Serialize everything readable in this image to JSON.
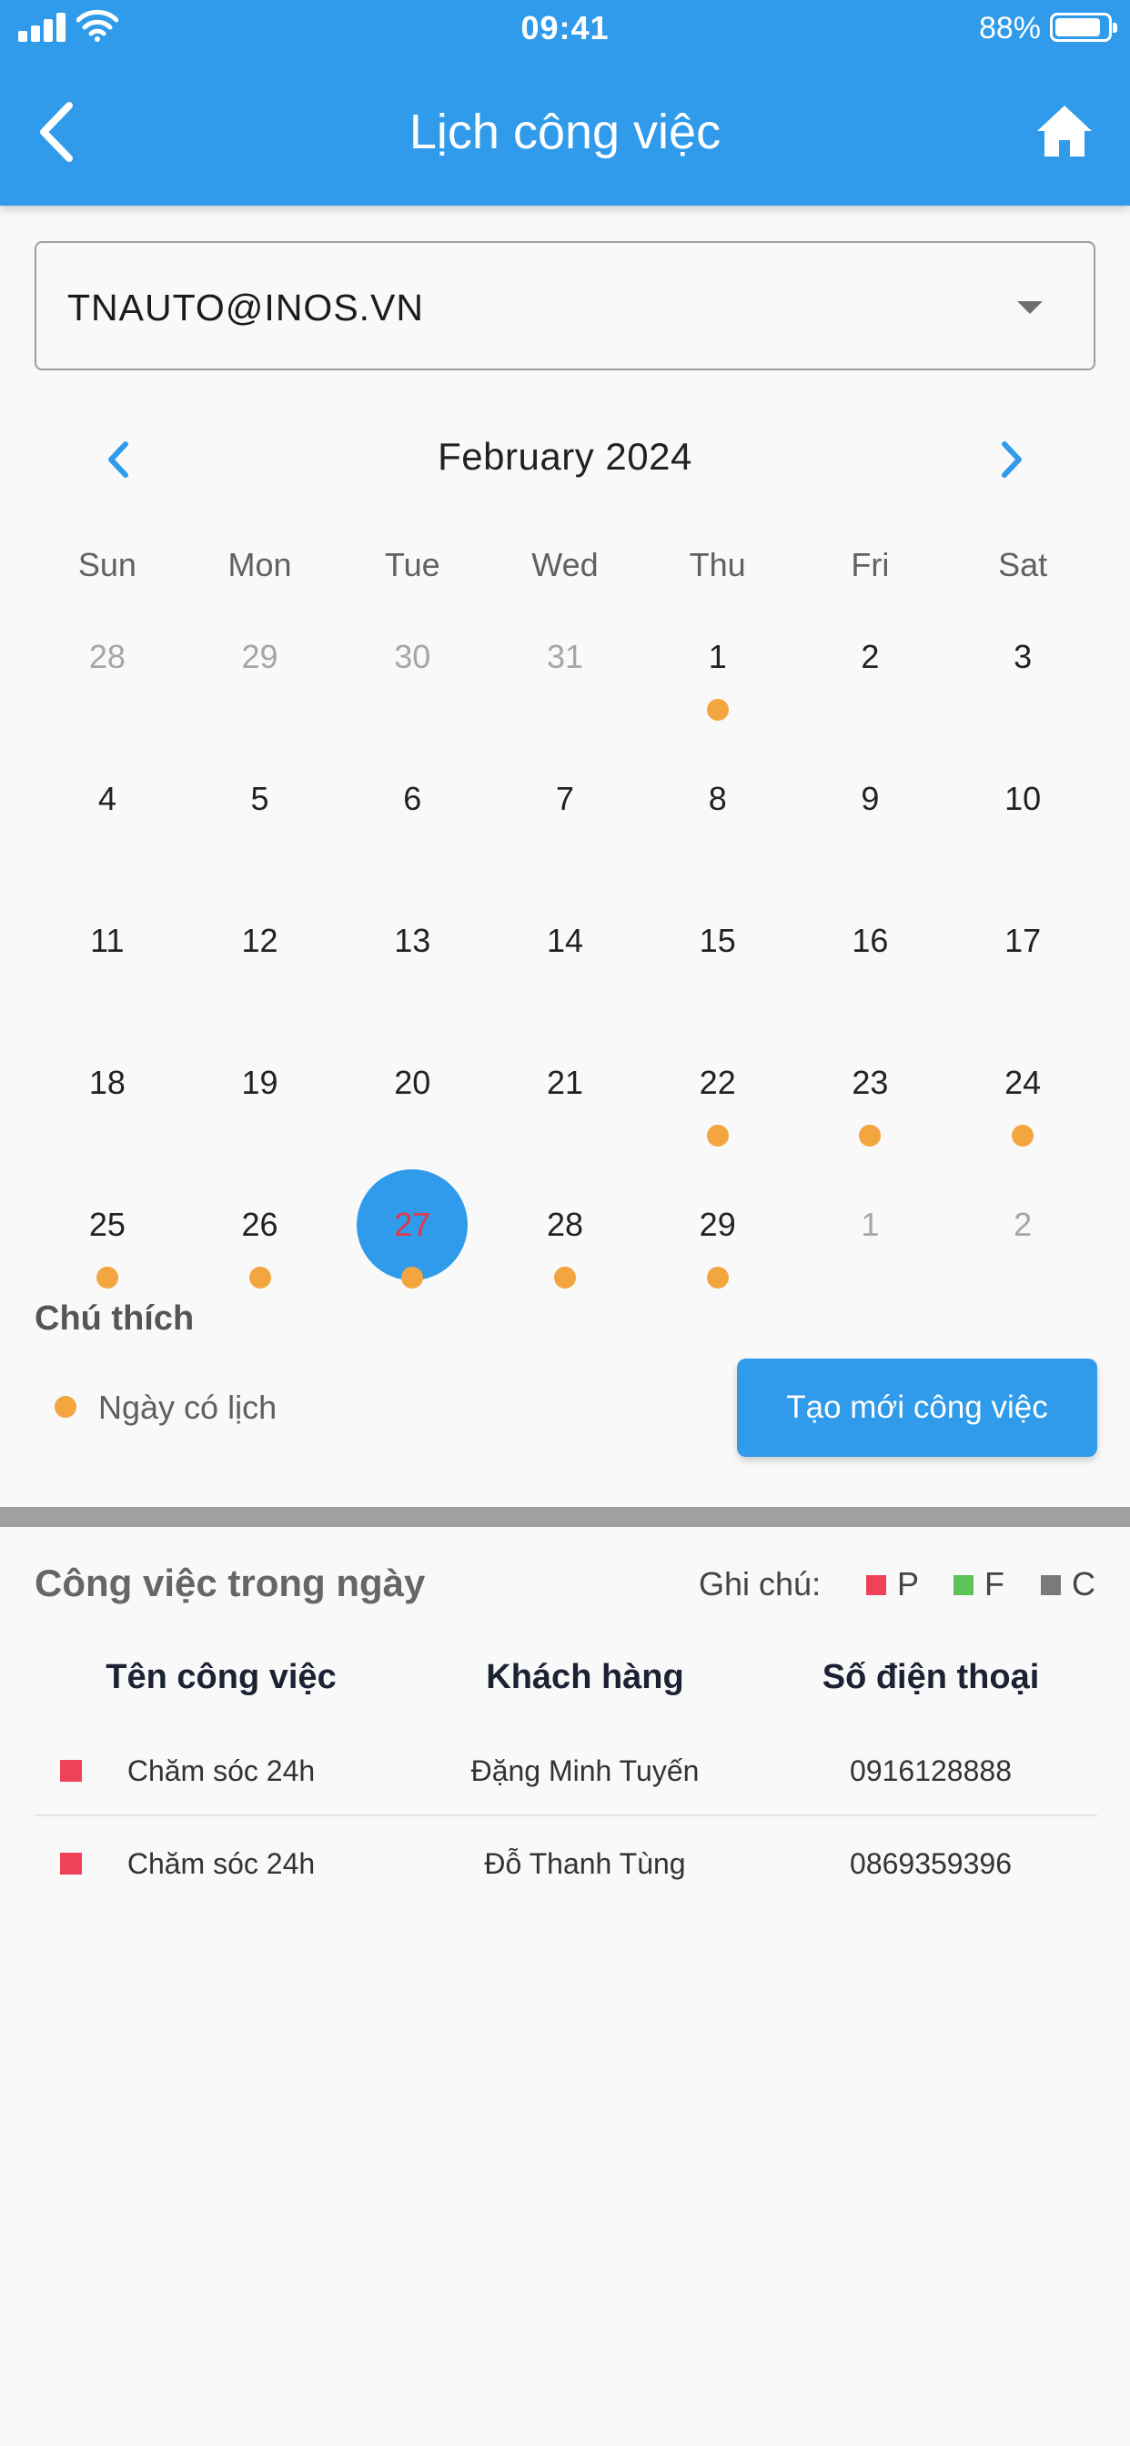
{
  "status_bar": {
    "time": "09:41",
    "battery_percent": "88%",
    "battery_level": 0.88
  },
  "app_bar": {
    "title": "Lịch công việc",
    "back_icon": "chevron-left-icon",
    "home_icon": "home-icon"
  },
  "account_select": {
    "value": "TNAUTO@INOS.VN"
  },
  "calendar": {
    "month_label": "February 2024",
    "weekdays": [
      "Sun",
      "Mon",
      "Tue",
      "Wed",
      "Thu",
      "Fri",
      "Sat"
    ],
    "days": [
      {
        "label": "28",
        "muted": true,
        "event": false
      },
      {
        "label": "29",
        "muted": true,
        "event": false
      },
      {
        "label": "30",
        "muted": true,
        "event": false
      },
      {
        "label": "31",
        "muted": true,
        "event": false
      },
      {
        "label": "1",
        "muted": false,
        "event": true
      },
      {
        "label": "2",
        "muted": false,
        "event": false
      },
      {
        "label": "3",
        "muted": false,
        "event": false
      },
      {
        "label": "4",
        "muted": false,
        "event": false
      },
      {
        "label": "5",
        "muted": false,
        "event": false
      },
      {
        "label": "6",
        "muted": false,
        "event": false
      },
      {
        "label": "7",
        "muted": false,
        "event": false
      },
      {
        "label": "8",
        "muted": false,
        "event": false
      },
      {
        "label": "9",
        "muted": false,
        "event": false
      },
      {
        "label": "10",
        "muted": false,
        "event": false
      },
      {
        "label": "11",
        "muted": false,
        "event": false
      },
      {
        "label": "12",
        "muted": false,
        "event": false
      },
      {
        "label": "13",
        "muted": false,
        "event": false
      },
      {
        "label": "14",
        "muted": false,
        "event": false
      },
      {
        "label": "15",
        "muted": false,
        "event": false
      },
      {
        "label": "16",
        "muted": false,
        "event": false
      },
      {
        "label": "17",
        "muted": false,
        "event": false
      },
      {
        "label": "18",
        "muted": false,
        "event": false
      },
      {
        "label": "19",
        "muted": false,
        "event": false
      },
      {
        "label": "20",
        "muted": false,
        "event": false
      },
      {
        "label": "21",
        "muted": false,
        "event": false
      },
      {
        "label": "22",
        "muted": false,
        "event": true
      },
      {
        "label": "23",
        "muted": false,
        "event": true
      },
      {
        "label": "24",
        "muted": false,
        "event": true
      },
      {
        "label": "25",
        "muted": false,
        "event": true
      },
      {
        "label": "26",
        "muted": false,
        "event": true
      },
      {
        "label": "27",
        "muted": false,
        "event": true,
        "selected": true
      },
      {
        "label": "28",
        "muted": false,
        "event": true
      },
      {
        "label": "29",
        "muted": false,
        "event": true
      },
      {
        "label": "1",
        "muted": true,
        "event": false
      },
      {
        "label": "2",
        "muted": true,
        "event": false
      }
    ]
  },
  "legend": {
    "title": "Chú thích",
    "item_label": "Ngày có lịch"
  },
  "create_button": {
    "label": "Tạo mới công việc"
  },
  "tasks": {
    "title": "Công việc trong ngày",
    "note_label": "Ghi chú:",
    "notes": [
      {
        "label": "P",
        "color": "#ee4257"
      },
      {
        "label": "F",
        "color": "#5cc25a"
      },
      {
        "label": "C",
        "color": "#7a7a7a"
      }
    ],
    "columns": [
      "Tên công việc",
      "Khách hàng",
      "Số điện thoại"
    ],
    "rows": [
      {
        "status_color": "#ee4257",
        "task": "Chăm sóc 24h",
        "customer": "Đặng Minh Tuyến",
        "phone": "0916128888"
      },
      {
        "status_color": "#ee4257",
        "task": "Chăm sóc 24h",
        "customer": "Đỗ Thanh Tùng",
        "phone": "0869359396"
      }
    ]
  },
  "colors": {
    "primary": "#2f9bea",
    "event_dot": "#f3a53f",
    "selected_day_text": "#e0394a"
  }
}
